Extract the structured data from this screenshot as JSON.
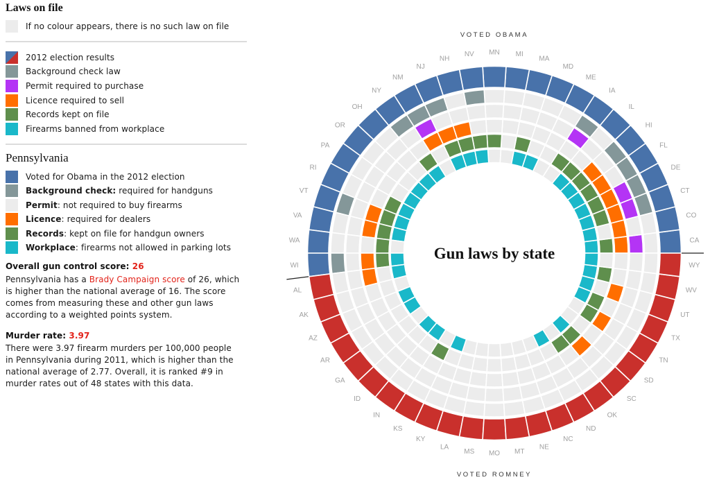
{
  "colors": {
    "obama": "#4872aa",
    "romney": "#c9302c",
    "background": "#849799",
    "permit": "#b434f5",
    "licence": "#ff6e00",
    "records": "#5f8f4d",
    "workplace": "#1ab8c9",
    "none": "#ececec",
    "accent_red": "#e2231a"
  },
  "legend": {
    "title": "Laws on file",
    "no_law_note": "If no colour appears, there is no such law on file",
    "items": [
      {
        "key": "election",
        "label": "2012 election results"
      },
      {
        "key": "background",
        "label": "Background check law"
      },
      {
        "key": "permit",
        "label": "Permit required to purchase"
      },
      {
        "key": "licence",
        "label": "Licence required to sell"
      },
      {
        "key": "records",
        "label": "Records kept on file"
      },
      {
        "key": "workplace",
        "label": "Firearms banned from workplace"
      }
    ]
  },
  "state_detail": {
    "name": "Pennsylvania",
    "items": [
      {
        "bold": "",
        "text": "Voted for Obama in the 2012 election",
        "color": "#4872aa"
      },
      {
        "bold": "Background check:",
        "text": " required for handguns",
        "color": "#849799"
      },
      {
        "bold": "Permit",
        "text": ": not required to buy firearms",
        "color": "#ececec"
      },
      {
        "bold": "Licence",
        "text": ": required for dealers",
        "color": "#ff6e00"
      },
      {
        "bold": "Records",
        "text": ": kept on file for handgun owners",
        "color": "#5f8f4d"
      },
      {
        "bold": "Workplace",
        "text": ": firearms not allowed in parking lots",
        "color": "#1ab8c9"
      }
    ],
    "score": {
      "label": "Overall gun control score: ",
      "value": "26",
      "text_before": "Pennsylvania has a ",
      "link": "Brady Campaign score",
      "text_after": " of 26, which is higher than the national average of 16. The score comes from measuring these and other gun laws according to a weighted points system."
    },
    "murder": {
      "label": "Murder rate: ",
      "value": "3.97",
      "text": "There were 3.97 firearm murders per 100,000 people in Pennsylvania during 2011, which is higher than the national average of 2.77. Overall, it is ranked #9 in murder rates out of 48 states with this data."
    }
  },
  "chart_data": {
    "type": "heatmap",
    "layout": "radial",
    "title": "Gun laws by state",
    "top_label": "VOTED OBAMA",
    "bottom_label": "VOTED ROMNEY",
    "rings": [
      "election",
      "background",
      "permit",
      "licence",
      "records",
      "workplace"
    ],
    "law_order": [
      "background",
      "permit",
      "licence",
      "records",
      "workplace"
    ],
    "states": [
      {
        "abbr": "CA",
        "vote": "Obama",
        "laws": [
          0,
          1,
          1,
          1,
          1
        ]
      },
      {
        "abbr": "CO",
        "vote": "Obama",
        "laws": [
          0,
          0,
          1,
          0,
          1
        ]
      },
      {
        "abbr": "CT",
        "vote": "Obama",
        "laws": [
          1,
          1,
          1,
          1,
          1
        ]
      },
      {
        "abbr": "DE",
        "vote": "Obama",
        "laws": [
          1,
          1,
          1,
          1,
          1
        ]
      },
      {
        "abbr": "FL",
        "vote": "Obama",
        "laws": [
          1,
          0,
          1,
          1,
          1
        ]
      },
      {
        "abbr": "HI",
        "vote": "Obama",
        "laws": [
          1,
          0,
          1,
          1,
          1
        ]
      },
      {
        "abbr": "IL",
        "vote": "Obama",
        "laws": [
          0,
          0,
          0,
          1,
          1
        ]
      },
      {
        "abbr": "IA",
        "vote": "Obama",
        "laws": [
          1,
          1,
          0,
          1,
          0
        ]
      },
      {
        "abbr": "ME",
        "vote": "Obama",
        "laws": [
          0,
          0,
          0,
          0,
          0
        ]
      },
      {
        "abbr": "MD",
        "vote": "Obama",
        "laws": [
          0,
          0,
          0,
          0,
          1
        ]
      },
      {
        "abbr": "MA",
        "vote": "Obama",
        "laws": [
          0,
          0,
          0,
          1,
          1
        ]
      },
      {
        "abbr": "MI",
        "vote": "Obama",
        "laws": [
          0,
          0,
          0,
          0,
          0
        ]
      },
      {
        "abbr": "MN",
        "vote": "Obama",
        "laws": [
          0,
          0,
          0,
          1,
          0
        ]
      },
      {
        "abbr": "NV",
        "vote": "Obama",
        "laws": [
          1,
          0,
          0,
          1,
          1
        ]
      },
      {
        "abbr": "NH",
        "vote": "Obama",
        "laws": [
          0,
          0,
          1,
          1,
          1
        ]
      },
      {
        "abbr": "NJ",
        "vote": "Obama",
        "laws": [
          1,
          0,
          1,
          1,
          1
        ]
      },
      {
        "abbr": "NM",
        "vote": "Obama",
        "laws": [
          1,
          1,
          1,
          0,
          0
        ]
      },
      {
        "abbr": "NY",
        "vote": "Obama",
        "laws": [
          1,
          0,
          0,
          1,
          1
        ]
      },
      {
        "abbr": "OH",
        "vote": "Obama",
        "laws": [
          0,
          0,
          0,
          0,
          1
        ]
      },
      {
        "abbr": "OR",
        "vote": "Obama",
        "laws": [
          0,
          0,
          0,
          0,
          1
        ]
      },
      {
        "abbr": "PA",
        "vote": "Obama",
        "laws": [
          0,
          0,
          0,
          0,
          1
        ]
      },
      {
        "abbr": "RI",
        "vote": "Obama",
        "laws": [
          0,
          0,
          0,
          1,
          1
        ]
      },
      {
        "abbr": "VT",
        "vote": "Obama",
        "laws": [
          1,
          0,
          1,
          1,
          1
        ]
      },
      {
        "abbr": "VA",
        "vote": "Obama",
        "laws": [
          0,
          0,
          1,
          1,
          1
        ]
      },
      {
        "abbr": "WA",
        "vote": "Obama",
        "laws": [
          0,
          0,
          0,
          1,
          0
        ]
      },
      {
        "abbr": "WI",
        "vote": "Obama",
        "laws": [
          1,
          0,
          1,
          1,
          1
        ]
      },
      {
        "abbr": "AL",
        "vote": "Romney",
        "laws": [
          0,
          0,
          1,
          0,
          1
        ]
      },
      {
        "abbr": "AK",
        "vote": "Romney",
        "laws": [
          0,
          0,
          0,
          0,
          0
        ]
      },
      {
        "abbr": "AZ",
        "vote": "Romney",
        "laws": [
          0,
          0,
          0,
          0,
          1
        ]
      },
      {
        "abbr": "AR",
        "vote": "Romney",
        "laws": [
          0,
          0,
          0,
          0,
          1
        ]
      },
      {
        "abbr": "GA",
        "vote": "Romney",
        "laws": [
          0,
          0,
          0,
          0,
          0
        ]
      },
      {
        "abbr": "ID",
        "vote": "Romney",
        "laws": [
          0,
          0,
          0,
          0,
          1
        ]
      },
      {
        "abbr": "IN",
        "vote": "Romney",
        "laws": [
          0,
          0,
          0,
          0,
          1
        ]
      },
      {
        "abbr": "KS",
        "vote": "Romney",
        "laws": [
          0,
          0,
          0,
          1,
          0
        ]
      },
      {
        "abbr": "KY",
        "vote": "Romney",
        "laws": [
          0,
          0,
          0,
          0,
          1
        ]
      },
      {
        "abbr": "LA",
        "vote": "Romney",
        "laws": [
          0,
          0,
          0,
          0,
          0
        ]
      },
      {
        "abbr": "MS",
        "vote": "Romney",
        "laws": [
          0,
          0,
          0,
          0,
          0
        ]
      },
      {
        "abbr": "MO",
        "vote": "Romney",
        "laws": [
          0,
          0,
          0,
          0,
          0
        ]
      },
      {
        "abbr": "MT",
        "vote": "Romney",
        "laws": [
          0,
          0,
          0,
          0,
          0
        ]
      },
      {
        "abbr": "NE",
        "vote": "Romney",
        "laws": [
          0,
          0,
          0,
          0,
          0
        ]
      },
      {
        "abbr": "NC",
        "vote": "Romney",
        "laws": [
          0,
          0,
          0,
          0,
          0
        ]
      },
      {
        "abbr": "ND",
        "vote": "Romney",
        "laws": [
          0,
          0,
          0,
          0,
          1
        ]
      },
      {
        "abbr": "OK",
        "vote": "Romney",
        "laws": [
          0,
          0,
          0,
          1,
          0
        ]
      },
      {
        "abbr": "SC",
        "vote": "Romney",
        "laws": [
          0,
          0,
          1,
          1,
          1
        ]
      },
      {
        "abbr": "SD",
        "vote": "Romney",
        "laws": [
          0,
          0,
          0,
          0,
          0
        ]
      },
      {
        "abbr": "TN",
        "vote": "Romney",
        "laws": [
          0,
          0,
          1,
          1,
          0
        ]
      },
      {
        "abbr": "TX",
        "vote": "Romney",
        "laws": [
          0,
          0,
          0,
          1,
          1
        ]
      },
      {
        "abbr": "UT",
        "vote": "Romney",
        "laws": [
          0,
          0,
          1,
          0,
          1
        ]
      },
      {
        "abbr": "WV",
        "vote": "Romney",
        "laws": [
          0,
          0,
          0,
          1,
          1
        ]
      },
      {
        "abbr": "WY",
        "vote": "Romney",
        "laws": [
          0,
          0,
          0,
          0,
          1
        ]
      }
    ]
  }
}
